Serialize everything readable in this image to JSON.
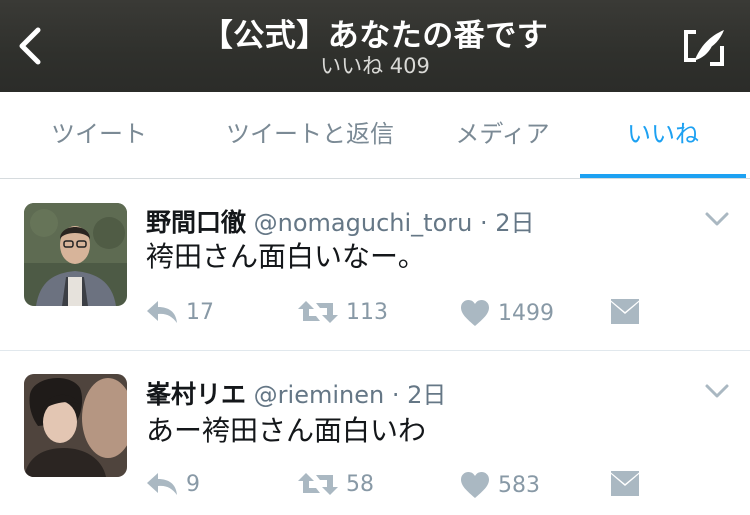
{
  "header": {
    "title": "【公式】あなたの番です",
    "subtitle": "いいね 409"
  },
  "tabs": [
    {
      "label": "ツイート"
    },
    {
      "label": "ツイートと返信"
    },
    {
      "label": "メディア"
    },
    {
      "label": "いいね",
      "active": true
    }
  ],
  "tweets": [
    {
      "name": "野間口徹",
      "handle": "@nomaguchi_toru",
      "time": "· 2日",
      "text": "袴田さん面白いなー。",
      "reply_count": "17",
      "retweet_count": "113",
      "like_count": "1499"
    },
    {
      "name": "峯村リエ",
      "handle": "@rieminen",
      "time": "· 2日",
      "text": "あー袴田さん面白いわ",
      "reply_count": "9",
      "retweet_count": "58",
      "like_count": "583"
    }
  ],
  "colors": {
    "accent": "#1da1f2",
    "header_bg": "#2f302c",
    "icon_gray": "#aab8c2",
    "count_gray": "#8899a6"
  }
}
